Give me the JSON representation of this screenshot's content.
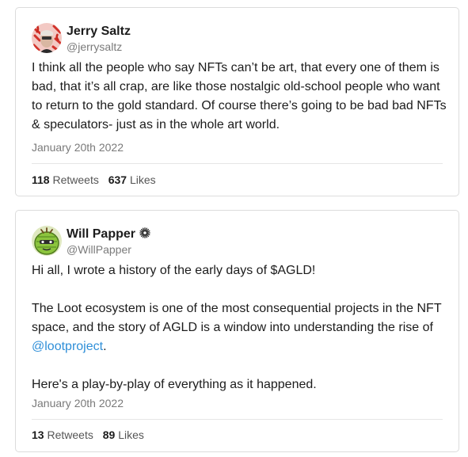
{
  "tweets": [
    {
      "author_name": "Jerry Saltz",
      "handle": "@jerrysaltz",
      "text": "I think all the people who say NFTs can’t be art, that every one of them is bad, that it’s all crap, are like those nostalgic old-school people who want to return to the gold standard. Of course there’s going to be bad bad NFTs & speculators- just as in the whole art world.",
      "date": "January 20th 2022",
      "retweets": "118",
      "retweets_label": "Retweets",
      "likes": "637",
      "likes_label": "Likes"
    },
    {
      "author_name": "Will Papper",
      "handle": "@WillPapper",
      "text_p1": "Hi all, I wrote a history of the early days of $AGLD!",
      "text_p2_before": "The Loot ecosystem is one of the most consequential projects in the NFT space, and the story of AGLD is a window into understanding the rise of ",
      "text_p2_mention": "@lootproject",
      "text_p2_after": ".",
      "text_p3": "Here's a play-by-play of everything as it happened.",
      "date": "January 20th 2022",
      "retweets": "13",
      "retweets_label": "Retweets",
      "likes": "89",
      "likes_label": "Likes"
    }
  ],
  "colors": {
    "mention": "#2f8fd8",
    "card_border": "#dcdcdc",
    "muted_text": "#7a7a7a"
  },
  "icons": {
    "tweet1_avatar": "avatar-jerry-saltz",
    "tweet2_avatar": "avatar-will-papper",
    "tweet2_name_badge": "sunburst-badge-icon"
  }
}
